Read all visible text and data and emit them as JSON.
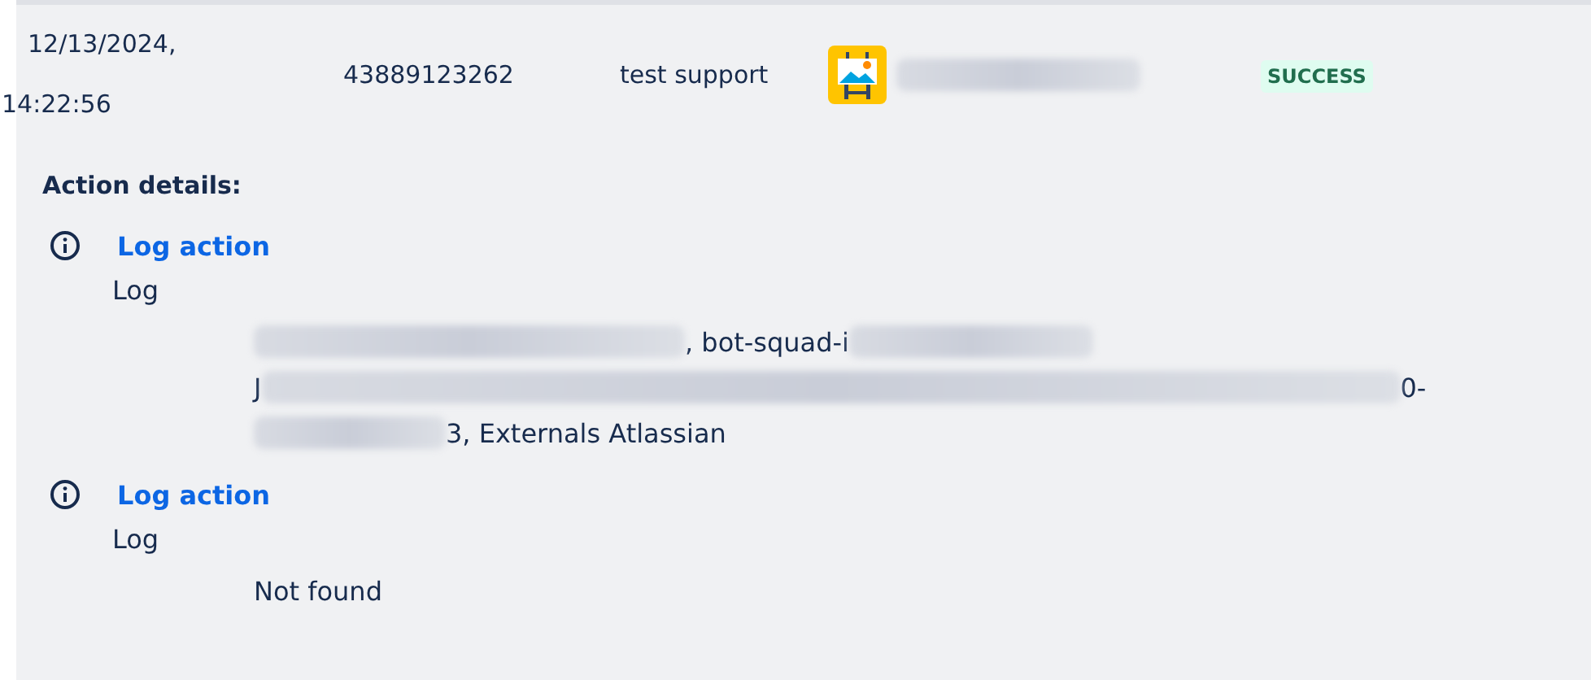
{
  "row": {
    "timestamp": "12/13/2024, 14:22:56",
    "id": "43889123262",
    "actor": "test support",
    "rule_name": {
      "kind": "redacted"
    },
    "status": {
      "label": "SUCCESS",
      "kind": "success"
    }
  },
  "details": {
    "heading": "Action details:",
    "actions": [
      {
        "title": "Log action",
        "type": "Log",
        "lines": [
          [
            {
              "kind": "redacted"
            },
            {
              "kind": "text",
              "text": ", bot-squad-i"
            },
            {
              "kind": "redacted"
            }
          ],
          [
            {
              "kind": "text",
              "text": "J"
            },
            {
              "kind": "redacted"
            },
            {
              "kind": "text",
              "text": "0-"
            }
          ],
          [
            {
              "kind": "redacted"
            },
            {
              "kind": "text",
              "text": "3, Externals Atlassian"
            }
          ]
        ]
      },
      {
        "title": "Log action",
        "type": "Log",
        "lines": [
          [
            {
              "kind": "text",
              "text": "Not found"
            }
          ]
        ]
      }
    ]
  }
}
